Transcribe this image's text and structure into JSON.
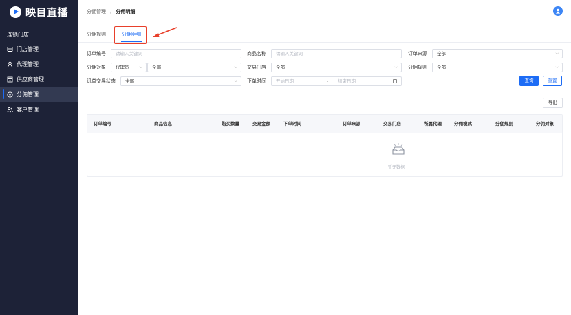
{
  "app": {
    "logo_text": "映目直播"
  },
  "sidebar": {
    "section_title": "连锁门店",
    "items": [
      {
        "label": "门店管理",
        "icon": "store-icon"
      },
      {
        "label": "代理管理",
        "icon": "agent-icon"
      },
      {
        "label": "供应商管理",
        "icon": "supplier-icon"
      },
      {
        "label": "分佣管理",
        "icon": "commission-icon",
        "active": true
      },
      {
        "label": "客户管理",
        "icon": "customers-icon"
      }
    ]
  },
  "header": {
    "breadcrumb": [
      "分佣管理",
      "分佣明细"
    ]
  },
  "tabs": [
    {
      "label": "分佣规则",
      "active": false
    },
    {
      "label": "分佣明细",
      "active": true
    }
  ],
  "filters": {
    "order_no": {
      "label": "订单编号",
      "placeholder": "请输入关键词"
    },
    "product_name": {
      "label": "商品名称",
      "placeholder": "请输入关键词"
    },
    "order_source": {
      "label": "订单来源",
      "value": "全部"
    },
    "commission_target": {
      "label": "分佣对象",
      "type_value": "代理员",
      "value": "全部"
    },
    "trade_store": {
      "label": "交易门店",
      "value": "全部"
    },
    "commission_rule": {
      "label": "分佣规则",
      "value": "全部"
    },
    "order_status": {
      "label": "订单交易状态",
      "value": "全部"
    },
    "order_time": {
      "label": "下单时间",
      "start_placeholder": "开始日期",
      "separator": "-",
      "end_placeholder": "结束日期"
    }
  },
  "actions": {
    "query": "查询",
    "reset": "重置",
    "export": "导出"
  },
  "table": {
    "columns": [
      "订单编号",
      "商品信息",
      "购买数量",
      "交易金额",
      "下单时间",
      "订单来源",
      "交易门店",
      "所属代理",
      "分佣模式",
      "分佣规则",
      "分佣对象"
    ],
    "empty_text": "暂无数据"
  },
  "colors": {
    "accent": "#1d6cf5",
    "sidebar_bg": "#1d2237",
    "highlight": "#e8402b"
  }
}
